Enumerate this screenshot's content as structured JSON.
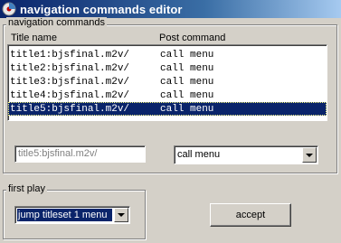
{
  "window": {
    "title": "navigation commands editor",
    "icon": "app-icon"
  },
  "navigation": {
    "group_label": "navigation commands",
    "columns": {
      "title_name": "Title name",
      "post_command": "Post command"
    },
    "rows": [
      {
        "title": "title1:bjsfinal.m2v/",
        "command": "call menu",
        "selected": false
      },
      {
        "title": "title2:bjsfinal.m2v/",
        "command": "call menu",
        "selected": false
      },
      {
        "title": "title3:bjsfinal.m2v/",
        "command": "call menu",
        "selected": false
      },
      {
        "title": "title4:bjsfinal.m2v/",
        "command": "call menu",
        "selected": false
      },
      {
        "title": "title5:bjsfinal.m2v/",
        "command": "call menu",
        "selected": true
      }
    ],
    "title_field_value": "title5:bjsfinal.m2v/",
    "command_select_value": "call menu"
  },
  "first_play": {
    "group_label": "first play",
    "select_value": "jump titleset 1 menu"
  },
  "accept_button": "accept",
  "colors": {
    "selection": "#0a246a",
    "face": "#d4d0c8"
  }
}
